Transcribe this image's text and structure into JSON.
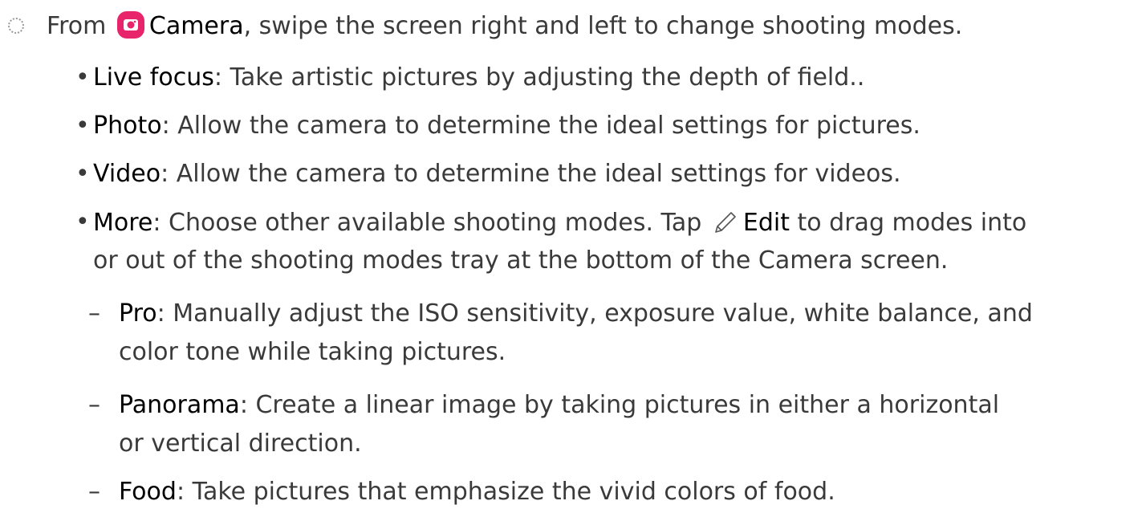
{
  "step": {
    "prefix": "From",
    "app_name": "Camera",
    "text": ", swipe the screen right and left to change shooting modes."
  },
  "modes": [
    {
      "term": "Live focus",
      "desc": ": Take artistic pictures by adjusting the depth of field.."
    },
    {
      "term": "Photo",
      "desc": ": Allow the camera to determine the ideal settings for pictures."
    },
    {
      "term": "Video",
      "desc": ": Allow the camera to determine the ideal settings for videos."
    }
  ],
  "more": {
    "term": "More",
    "desc_part1": ": Choose other available shooting modes. Tap",
    "edit_label": "Edit",
    "desc_part2": "to drag modes into",
    "desc_line2": "or out of the shooting modes tray at the bottom of the Camera screen."
  },
  "submodes": [
    {
      "term": "Pro",
      "line1": ": Manually adjust the ISO sensitivity, exposure value, white balance, and",
      "line2": "color tone while taking pictures."
    },
    {
      "term": "Panorama",
      "line1": ": Create a linear image by taking pictures in either a horizontal",
      "line2": "or vertical direction."
    },
    {
      "term": "Food",
      "line1": ": Take pictures that emphasize the vivid colors of food.",
      "line2": ""
    }
  ],
  "colors": {
    "camera_icon": "#e8246a",
    "body_text": "#3a3a3a",
    "term_text": "#000000"
  },
  "icons": {
    "step": "dotted-circle-icon",
    "camera": "camera-icon",
    "edit": "pencil-icon"
  }
}
